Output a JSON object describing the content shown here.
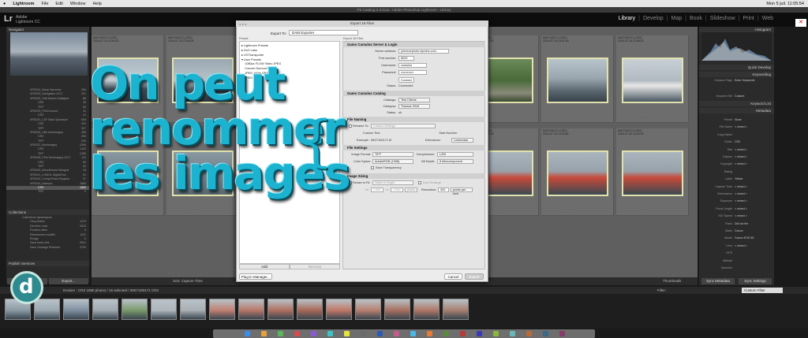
{
  "menubar": {
    "apple": "",
    "items": [
      "Lightroom",
      "File",
      "Edit",
      "Window",
      "Help"
    ],
    "right": "Mon 5 juil. 11:05:54"
  },
  "window_title": "PS Catalog-2-3.lrcat - Adobe Photoshop Lightroom - Library",
  "identity": {
    "logo": "Lr",
    "line1": "Adobe",
    "line2": "Lightroom CC"
  },
  "modules": [
    "Library",
    "Develop",
    "Map",
    "Book",
    "Slideshow",
    "Print",
    "Web"
  ],
  "left_panel": {
    "navigator": "Navigator",
    "folders": [
      {
        "name": "XRS024_Barry Sarnovar",
        "count": "354"
      },
      {
        "name": "XRS025_Navigation 2017",
        "count": "201"
      },
      {
        "name": "XRS026_Salt-Marrie-Gallagher",
        "count": "88"
      },
      {
        "name": "CRZ",
        "count": "36"
      },
      {
        "name": "TIFF",
        "count": "52"
      },
      {
        "name": "XRS029_Phil Dumont",
        "count": "41"
      },
      {
        "name": "CRZ",
        "count": "21"
      },
      {
        "name": "XRS031_LSF Salut Spectacle",
        "count": "608"
      },
      {
        "name": "CRZ",
        "count": "301"
      },
      {
        "name": "TIFF",
        "count": "307"
      },
      {
        "name": "XRS034_Ville Montmagny",
        "count": "455"
      },
      {
        "name": "CRZ",
        "count": "250"
      },
      {
        "name": "TIFF",
        "count": "205"
      },
      {
        "name": "XRS037_Montmagny",
        "count": "2390"
      },
      {
        "name": "CRZ",
        "count": "1110"
      },
      {
        "name": "TIFF",
        "count": "1280"
      },
      {
        "name": "XRS038_Fête Montmagny 2017",
        "count": "112"
      },
      {
        "name": "CRZ",
        "count": "60"
      },
      {
        "name": "TIFF",
        "count": "52"
      },
      {
        "name": "XRS040_Mounthouse Mongraf",
        "count": "44"
      },
      {
        "name": "XRS041_LOMOL DigitalTour",
        "count": "61"
      },
      {
        "name": "XRS042_CompaThant Equipes",
        "count": "97"
      },
      {
        "name": "XRS044_Bateaux",
        "count": "1880"
      },
      {
        "name": "CRZ",
        "count": "1880",
        "selected": true
      },
      {
        "name": "TIFF",
        "count": "0"
      }
    ],
    "collections_title": "Collections",
    "collections": [
      {
        "name": "Collections dynamiques",
        "count": ""
      },
      {
        "name": "Cinq étoiles",
        "count": "1479"
      },
      {
        "name": "Derniers mois",
        "count": "2813"
      },
      {
        "name": "Fichiers vidéo",
        "count": "9"
      },
      {
        "name": "Récemment modifié",
        "count": "1121"
      },
      {
        "name": "Rouge",
        "count": "0"
      },
      {
        "name": "Sans mots-clés",
        "count": "4001"
      },
      {
        "name": "Sans Géotags Pertinent",
        "count": "3790"
      }
    ],
    "publish_title": "Publish Services",
    "import_btn": "Import...",
    "export_btn": "Export..."
  },
  "grid": {
    "sort_label": "Sort:  Capture Time",
    "thumbnails_label": "Thumbnails",
    "cells": [
      {
        "label": "IMG7160171 (CR2)\n2016-07-15 13:54:20"
      },
      {
        "label": "IMG7160171 (CR2)\n2016-07-15 13:54:25"
      },
      {
        "label": ""
      },
      {
        "label": ""
      },
      {
        "label": ""
      },
      {
        "label": "IMG7160171 (CR2)\n2016-07-15 13:57:10"
      },
      {
        "label": "IMG7160171 (CR2)\n2016-07-15 13:57:40"
      },
      {
        "label": "IMG7160171 (CR2)\n2016-07-15 13:58:20"
      },
      {
        "label": ""
      },
      {
        "label": ""
      },
      {
        "label": ""
      },
      {
        "label": ""
      },
      {
        "label": ""
      },
      {
        "label": "IMG7160171 (CR2)\n2016-07-15 14:02:15"
      },
      {
        "label": "IMG7160171 (CR2)\n2016-07-15 14:03:05"
      },
      {
        "label": "IMG7160171 (CR2)\n2016-07-15 14:03:40"
      }
    ]
  },
  "right_panel": {
    "histogram": "Histogram",
    "quick_develop": "Quick Develop",
    "keywording": "Keywording",
    "keyword_list": "Keyword List",
    "metadata": "Metadata",
    "keyword_tags_label": "Keyword Tags",
    "keyword_tags_value": "Enter Keywords",
    "keyword_set_label": "Keyword Set",
    "keyword_set_value": "Custom",
    "metadata_rows": [
      {
        "k": "Preset",
        "v": "None"
      },
      {
        "k": "File Name",
        "v": "< mixed >"
      },
      {
        "k": "Copy Name",
        "v": ""
      },
      {
        "k": "Folder",
        "v": "CR2"
      },
      {
        "k": "Title",
        "v": "< mixed >"
      },
      {
        "k": "Caption",
        "v": "< mixed >"
      },
      {
        "k": "Copyright",
        "v": "< mixed >"
      },
      {
        "k": "Rating",
        "v": ""
      },
      {
        "k": "Label",
        "v": "Yellow"
      },
      {
        "k": "Capture Time",
        "v": "< mixed >"
      },
      {
        "k": "Dimensions",
        "v": "< mixed >"
      },
      {
        "k": "Exposure",
        "v": "< mixed >"
      },
      {
        "k": "Focal Length",
        "v": "< mixed >"
      },
      {
        "k": "ISO Speed",
        "v": "< mixed >"
      },
      {
        "k": "Flash",
        "v": "Did not fire"
      },
      {
        "k": "Make",
        "v": "Canon"
      },
      {
        "k": "Model",
        "v": "Canon EOS 5D"
      },
      {
        "k": "Lens",
        "v": "< mixed >"
      },
      {
        "k": "GPS",
        "v": ""
      },
      {
        "k": "Altitude",
        "v": ""
      },
      {
        "k": "Direction",
        "v": ""
      }
    ],
    "sync_metadata": "Sync Metadata",
    "sync_settings": "Sync Settings"
  },
  "filmstrip": {
    "path": "Dossier : CRZ   1880 photos / 16 selected / IMG7160171 CR2",
    "filter_label": "Filter :",
    "filter_value": "Custom Filter"
  },
  "dialog": {
    "title": "Export 16 Files",
    "export_to_label": "Export To:",
    "export_to_value": "DAM Exporter",
    "preset_label": "Preset:",
    "to_files_label": "Export 16 Files",
    "presets": [
      "▸ Lightroom Presets",
      "▸ DxO Labs",
      "▸ LR/Transporter",
      "▾ User Presets",
      "    1080px FLOW Video JPEG",
      "    Convert Dumont Web",
      "    JPEG 100% GPS cc",
      "    JPEG pour PDF"
    ],
    "add": "Add",
    "remove": "Remove",
    "plugin_manager": "Plug-in Manager...",
    "cancel": "Cancel",
    "export": "Export",
    "sections": {
      "server": "Gamo Cumulus Server & Login",
      "catalog": "Gamo Cumulus Catalog",
      "naming": "File Naming",
      "settings": "File Settings",
      "sizing": "Image Sizing"
    },
    "server": {
      "address_label": "Server address:",
      "address_value": "johnmarphoto.dyndns.com",
      "port_label": "Port number:",
      "port_value": "8000",
      "user_label": "Username:",
      "user_value": "cumulus",
      "pass_label": "Password:",
      "pass_value": "••••••••••••",
      "connect": "Connect",
      "status_label": "Status:",
      "status_value": "Connected"
    },
    "catalog": {
      "catalogs_label": "Catalogs:",
      "catalogs_value": "Test Clients",
      "category_label": "Category:",
      "category_value": "Travaux 2016",
      "status_label": "Status:",
      "status_value": "ok"
    },
    "naming": {
      "rename_label": "Rename To:",
      "rename_value": "Custom Settings",
      "custom_text_label": "Custom Text:",
      "start_number_label": "Start Number:",
      "example_label": "Example:",
      "example_value": "IMG7160171.tif",
      "extensions_label": "Extensions:",
      "extensions_value": "Lowercase"
    },
    "file_settings": {
      "format_label": "Image Format:",
      "format_value": "TIFF",
      "compression_label": "Compression:",
      "compression_value": "LZW",
      "colorspace_label": "Color Space:",
      "colorspace_value": "AdobeRGB (1998)",
      "bitdepth_label": "Bit Depth:",
      "bitdepth_value": "8 bits/component",
      "transparency_label": "Save Transparency"
    },
    "sizing": {
      "resize_label": "Resize to Fit:",
      "resize_value": "Width & Height",
      "enlarge_label": "Don't Enlarge",
      "w_label": "W:",
      "w_value": "1 000",
      "h_label": "H:",
      "h_value": "1 000",
      "unit_value": "pixels",
      "resolution_label": "Resolution:",
      "resolution_value": "300",
      "resolution_unit": "pixels per inch"
    }
  },
  "overlay": {
    "line1": "On peut",
    "line2": "renommer",
    "line3": "les images",
    "brace": "{"
  },
  "colors": {
    "overlay": "#1bb3d0",
    "overlay_shadow": "#0a4f5e",
    "thumb_border": "#e2e2ae",
    "logo_ring": "#c7e7e0"
  }
}
